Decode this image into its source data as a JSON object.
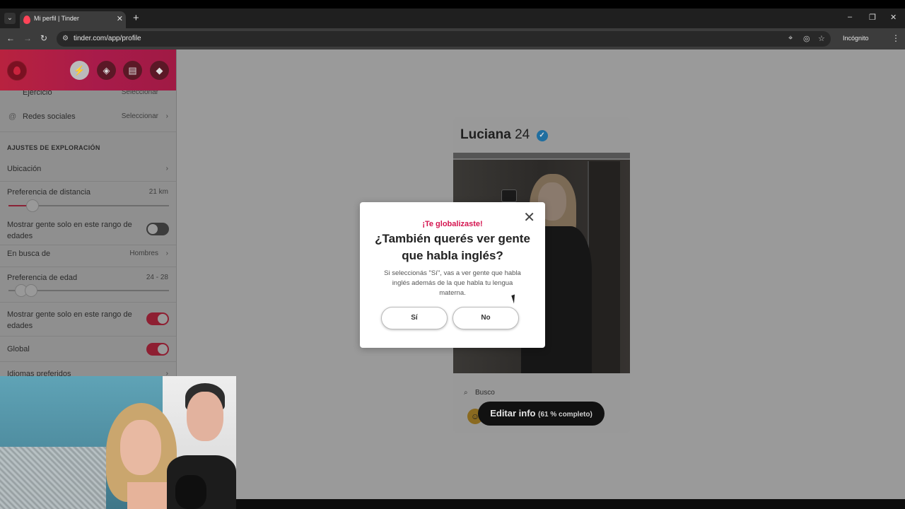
{
  "browser": {
    "tab_title": "Mi perfil | Tinder",
    "tab_search_icon": "chevron-down-icon",
    "url": "tinder.com/app/profile",
    "incognito_label": "Incógnito",
    "controls": {
      "minimize": "–",
      "restore": "❐",
      "close": "✕",
      "new_tab": "+",
      "tab_close": "✕",
      "back": "←",
      "forward": "→",
      "reload": "↻",
      "menu": "⋮"
    }
  },
  "sidebar": {
    "header_icons": [
      "lightning-icon",
      "compass-icon",
      "briefcase-icon",
      "shield-icon"
    ],
    "rows_top": [
      {
        "label": "Ejercicio",
        "value": "Seleccionar"
      },
      {
        "label": "Redes sociales",
        "value": "Seleccionar"
      }
    ],
    "section_title": "AJUSTES DE EXPLORACIÓN",
    "location_label": "Ubicación",
    "distance": {
      "label": "Preferencia de distancia",
      "value": "21 km",
      "fraction": 0.15
    },
    "distance_toggle_label": "Mostrar gente solo en este rango de edades",
    "distance_toggle_on": false,
    "looking_for": {
      "label": "En busca de",
      "value": "Hombres"
    },
    "age": {
      "label": "Preferencia de edad",
      "value": "24 - 28",
      "min_fraction": 0.08,
      "max_fraction": 0.14
    },
    "age_toggle_label": "Mostrar gente solo en este rango de edades",
    "age_toggle_on": true,
    "global_label": "Global",
    "global_on": true,
    "languages_label": "Idiomas preferidos"
  },
  "profile": {
    "name": "Luciana",
    "age": "24",
    "verified": true,
    "search_label": "Busco",
    "edit_button": "Editar info",
    "edit_progress": "(61 % completo)"
  },
  "modal": {
    "kicker": "¡Te globalizaste!",
    "title": "¿También querés ver gente que habla inglés?",
    "body": "Si seleccionás \"Sí\", vas a ver gente que habla inglés además de la que habla tu lengua materna.",
    "yes_label": "Sí",
    "no_label": "No",
    "close_icon": "close-icon"
  },
  "colors": {
    "tinder_pink": "#d4144f",
    "toggle_on": "#8e1f32",
    "verified_blue": "#1f6ea0"
  }
}
